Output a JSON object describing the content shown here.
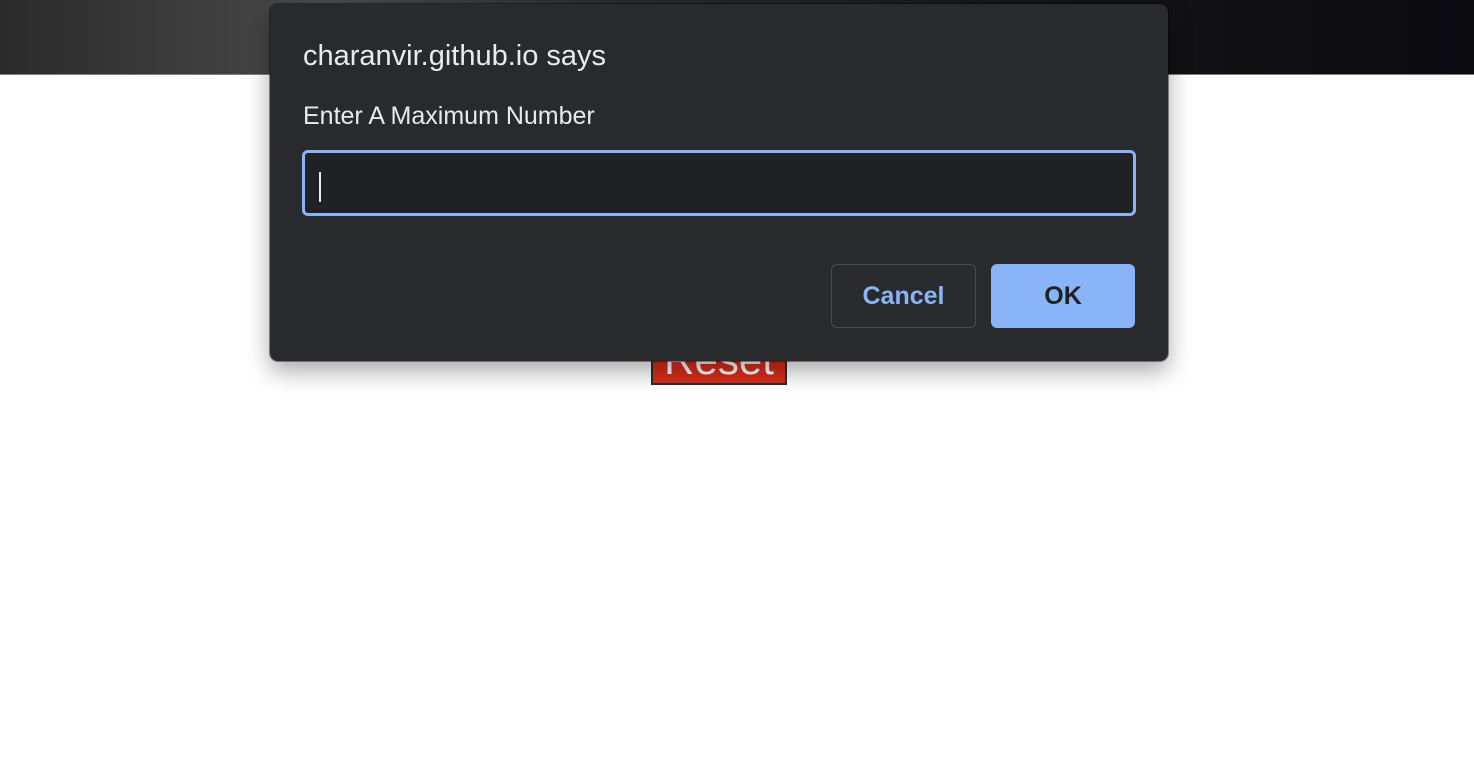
{
  "background_page": {
    "reset_label": "Reset"
  },
  "dialog": {
    "title": "charanvir.github.io says",
    "message": "Enter A Maximum Number",
    "input_value": "",
    "cancel_label": "Cancel",
    "ok_label": "OK"
  },
  "colors": {
    "dialog_bg": "#292a2d",
    "accent": "#8ab4f8",
    "reset_red": "#d82d1a"
  }
}
